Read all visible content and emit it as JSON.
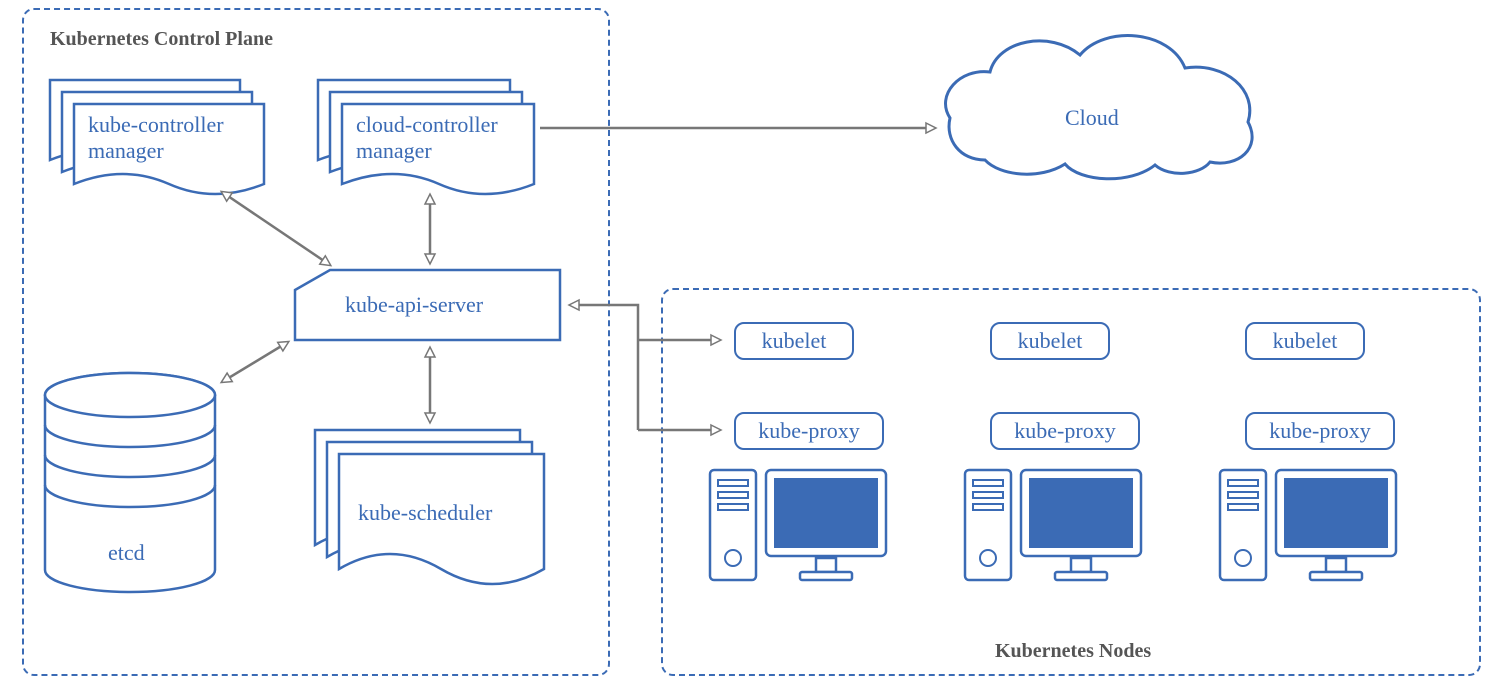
{
  "controlPlane": {
    "title": "Kubernetes Control Plane",
    "kubeControllerManager": "kube-controller\nmanager",
    "kubeControllerManagerL1": "kube-controller",
    "kubeControllerManagerL2": "manager",
    "cloudControllerManager": "cloud-controller\nmanager",
    "cloudControllerManagerL1": "cloud-controller",
    "cloudControllerManagerL2": "manager",
    "kubeApiServer": "kube-api-server",
    "etcd": "etcd",
    "kubeScheduler": "kube-scheduler"
  },
  "cloud": {
    "label": "Cloud"
  },
  "nodes": {
    "title": "Kubernetes Nodes",
    "items": [
      {
        "kubelet": "kubelet",
        "kubeProxy": "kube-proxy"
      },
      {
        "kubelet": "kubelet",
        "kubeProxy": "kube-proxy"
      },
      {
        "kubelet": "kubelet",
        "kubeProxy": "kube-proxy"
      }
    ]
  },
  "colors": {
    "primary": "#3b6bb5",
    "arrow": "#777",
    "sectionTitle": "#555"
  }
}
